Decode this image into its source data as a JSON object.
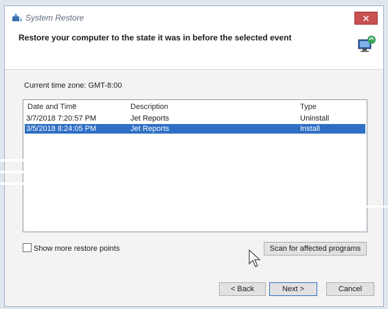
{
  "window": {
    "title": "System Restore",
    "close_label": "✕"
  },
  "header": {
    "heading": "Restore your computer to the state it was in before the selected event"
  },
  "timezone": "Current time zone: GMT-8:00",
  "list": {
    "columns": {
      "date": "Date and Time",
      "description": "Description",
      "type": "Type"
    },
    "rows": [
      {
        "date": "3/7/2018 7:20:57 PM",
        "description": "Jet Reports",
        "type": "Uninstall"
      },
      {
        "date": "3/5/2018 8:24:05 PM",
        "description": "Jet Reports",
        "type": "Install"
      }
    ]
  },
  "checkbox": {
    "label": "Show more restore points"
  },
  "buttons": {
    "scan": "Scan for affected programs",
    "back": "< Back",
    "next": "Next >",
    "cancel": "Cancel"
  }
}
